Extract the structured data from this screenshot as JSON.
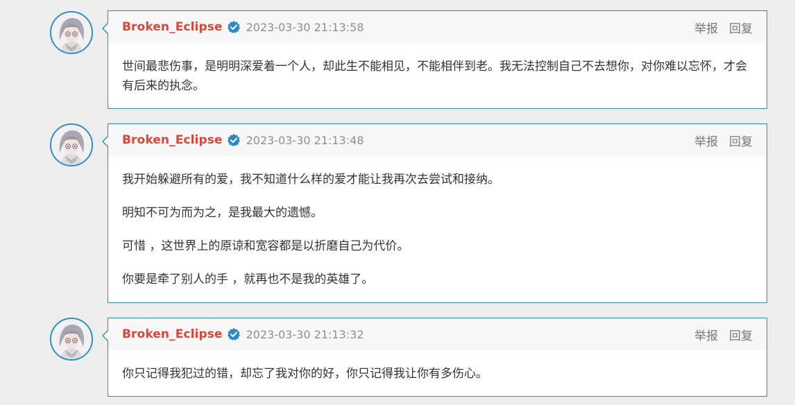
{
  "colors": {
    "author": "#d9473a",
    "accent_border": "#2b8cc4",
    "verified_badge": "#2b8cc4",
    "header_bg": "#f7f7f7",
    "page_bg": "#ededed"
  },
  "icons": {
    "verified": "verified-check-badge",
    "avatar": "anime-character-avatar"
  },
  "comments": [
    {
      "author": "Broken_Eclipse",
      "time": "2023-03-30 21:13:58",
      "report_label": "举报",
      "reply_label": "回复",
      "paragraphs": [
        "世间最悲伤事，是明明深爱着一个人，却此生不能相见，不能相伴到老。我无法控制自己不去想你，对你难以忘怀，才会有后来的执念。"
      ]
    },
    {
      "author": "Broken_Eclipse",
      "time": "2023-03-30 21:13:48",
      "report_label": "举报",
      "reply_label": "回复",
      "paragraphs": [
        "我开始躲避所有的爱，我不知道什么样的爱才能让我再次去尝试和接纳。",
        "明知不可为而为之，是我最大的遗憾。",
        "可惜 ，这世界上的原谅和宽容都是以折磨自己为代价。",
        "你要是牵了别人的手 ，就再也不是我的英雄了。"
      ]
    },
    {
      "author": "Broken_Eclipse",
      "time": "2023-03-30 21:13:32",
      "report_label": "举报",
      "reply_label": "回复",
      "paragraphs": [
        "你只记得我犯过的错，却忘了我对你的好，你只记得我让你有多伤心。"
      ]
    }
  ]
}
